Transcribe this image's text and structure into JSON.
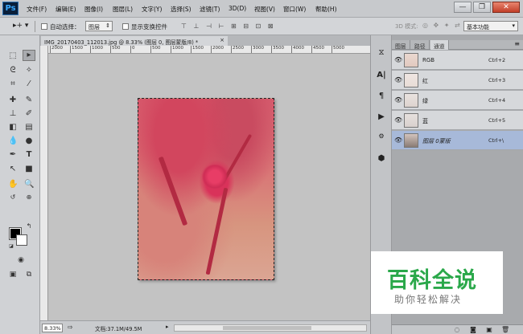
{
  "menubar": {
    "logo": "Ps",
    "items": [
      "文件(F)",
      "编辑(E)",
      "图像(I)",
      "图层(L)",
      "文字(Y)",
      "选择(S)",
      "滤镜(T)",
      "3D(D)",
      "视图(V)",
      "窗口(W)",
      "帮助(H)"
    ],
    "window_buttons": {
      "minimize": "—",
      "restore": "❐",
      "close": "✕"
    }
  },
  "options": {
    "auto_select_label": "自动选择：",
    "auto_select_value": "图层",
    "show_transform_label": "显示变换控件",
    "mode_3d_label": "3D 模式:",
    "workspace": "基本功能"
  },
  "document": {
    "tab_title": "IMG_20170403_112013.jpg @ 8.33% (图层 0, 图层蒙版/8) *",
    "tab_close": "×",
    "ruler_ticks": [
      "2000",
      "1500",
      "1000",
      "500",
      "0",
      "500",
      "1000",
      "1500",
      "2000",
      "2500",
      "3000",
      "3500",
      "4000",
      "4500",
      "5000"
    ]
  },
  "status": {
    "zoom": "8.33%",
    "doc_info": "文档:37.1M/49.5M"
  },
  "panels": {
    "tabs": [
      "图层",
      "路径",
      "通道"
    ],
    "active_tab": "通道",
    "channels": [
      {
        "name": "RGB",
        "shortcut": "Ctrl+2"
      },
      {
        "name": "红",
        "shortcut": "Ctrl+3"
      },
      {
        "name": "绿",
        "shortcut": "Ctrl+4"
      },
      {
        "name": "蓝",
        "shortcut": "Ctrl+5"
      },
      {
        "name": "图层 0蒙版",
        "shortcut": "Ctrl+\\"
      }
    ]
  },
  "watermark": {
    "title": "百科全说",
    "subtitle": "助你轻松解决"
  },
  "colors": {
    "selected_row": "#a7b9d9",
    "brand_green": "#2aa84a"
  }
}
